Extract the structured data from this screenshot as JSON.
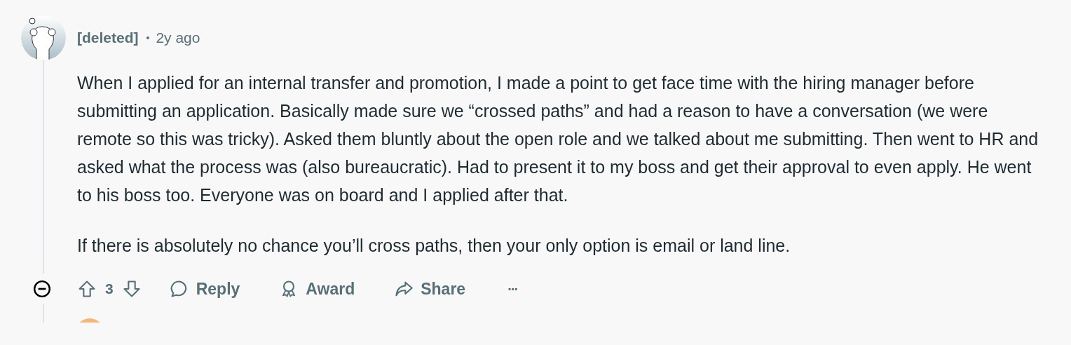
{
  "comment": {
    "author": "[deleted]",
    "separator": "•",
    "time": "2y ago",
    "expanded": true,
    "body": [
      "When I applied for an internal transfer and promotion, I made a point to get face time with the hiring manager before submitting an application. Basically made sure we “crossed paths” and had a reason to have a conversation (we were remote so this was tricky). Asked them bluntly about the open role and we talked about me submitting. Then went to HR and asked what the process was (also bureaucratic). Had to present it to my boss and get their approval to even apply. He went to his boss too. Everyone was on board and I applied after that.",
      "If there is absolutely no chance you’ll cross paths, then your only option is email or land line."
    ],
    "score": "3",
    "actions": [
      {
        "kind": "reply",
        "label": "Reply"
      },
      {
        "kind": "award",
        "label": "Award"
      },
      {
        "kind": "share",
        "label": "Share"
      },
      {
        "kind": "more",
        "label": "···"
      }
    ]
  }
}
